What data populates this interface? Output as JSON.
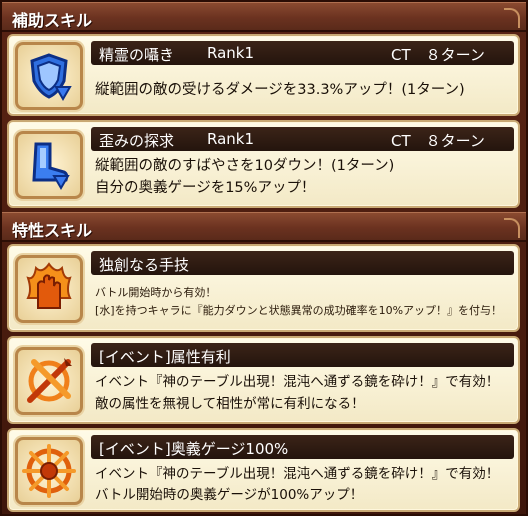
{
  "support_header": "補助スキル",
  "trait_header": "特性スキル",
  "support_skills": [
    {
      "name": "精霊の囁き",
      "rank": "Rank1",
      "ct": "CT　８ターン",
      "lines": [
        "縦範囲の敵の受けるダメージを33.3%アップ！(1ターン)"
      ],
      "icon": "shield-down-icon"
    },
    {
      "name": "歪みの探求",
      "rank": "Rank1",
      "ct": "CT　８ターン",
      "lines": [
        "縦範囲の敵のすばやさを10ダウン！(1ターン)",
        "自分の奥義ゲージを15%アップ！"
      ],
      "icon": "boot-down-icon"
    }
  ],
  "trait_skills": [
    {
      "name": "独創なる手技",
      "lines": [
        "バトル開始時から有効！",
        "[水]を持つキャラに『能力ダウンと状態異常の成功確率を10%アップ！』を付与！"
      ],
      "icon": "flame-hand-icon"
    },
    {
      "name": "[イベント]属性有利",
      "lines": [
        "イベント『神のテーブル出現！混沌へ通ずる鏡を砕け！』で有効！",
        "敵の属性を無視して相性が常に有利になる！"
      ],
      "icon": "crossed-swords-icon"
    },
    {
      "name": "[イベント]奥義ゲージ100%",
      "lines": [
        "イベント『神のテーブル出現！混沌へ通ずる鏡を砕け！』で有効！",
        "バトル開始時の奥義ゲージが100%アップ！"
      ],
      "icon": "burst-wheel-icon"
    }
  ],
  "colors": {
    "background": "#4a1c10",
    "card": "#fbf4dc",
    "title_bar": "#2e1a10",
    "accent_orange": "#f07a10",
    "accent_blue": "#2a6ae0"
  }
}
